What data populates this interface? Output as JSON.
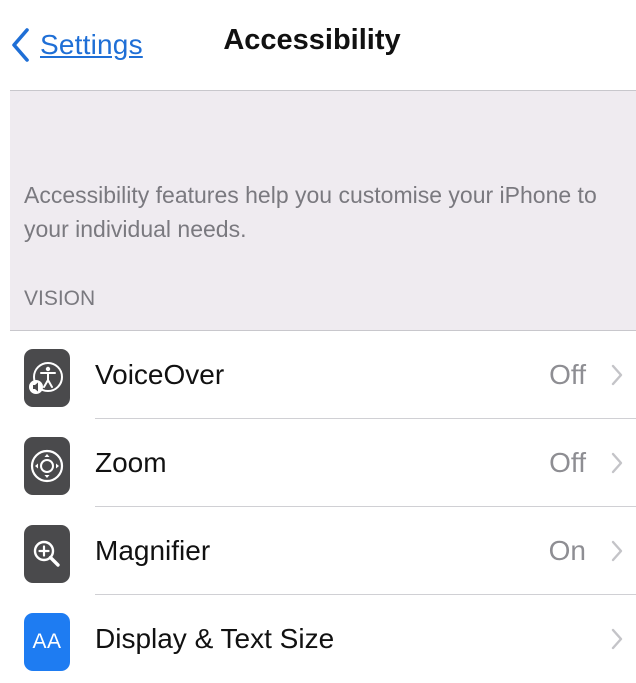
{
  "nav": {
    "back_label": "Settings",
    "back_icon": "chevron-left-icon",
    "title": "Accessibility"
  },
  "description": "Accessibility features help you customise your iPhone to your individual needs.",
  "section": {
    "header": "VISION"
  },
  "rows": [
    {
      "icon": "voiceover-icon",
      "label": "VoiceOver",
      "value": "Off"
    },
    {
      "icon": "zoom-icon",
      "label": "Zoom",
      "value": "Off"
    },
    {
      "icon": "magnifier-icon",
      "label": "Magnifier",
      "value": "On"
    },
    {
      "icon": "display-text-size-icon",
      "icon_text": "AA",
      "label": "Display & Text Size",
      "value": ""
    }
  ],
  "colors": {
    "accent": "#1f6fd6",
    "grouped_background": "#efebf0",
    "icon_dark": "#4a4a4c",
    "icon_blue": "#1e7cf2",
    "secondary_text": "#8e8e93"
  }
}
